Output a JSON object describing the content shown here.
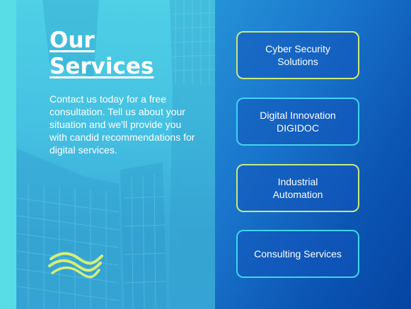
{
  "hero": {
    "heading_line1": "Our",
    "heading_line2": "Services",
    "description": "Contact us today for a free consultation. Tell us about your situation and we'll provide you with candid recommendations for digital services."
  },
  "services": [
    {
      "label": "Cyber Security\nSolutions"
    },
    {
      "label": "Digital Innovation\nDIGIDOC"
    },
    {
      "label": "Industrial\nAutomation"
    },
    {
      "label": "Consulting Services"
    }
  ],
  "colors": {
    "accent_green": "#c8e97c",
    "accent_cyan": "#3fd4ef",
    "panel_cyan": "#4fd0e6",
    "background_blue": "#0b56b0"
  },
  "icons": {
    "logo": "wave-logo-icon",
    "background": "office-building-image"
  }
}
